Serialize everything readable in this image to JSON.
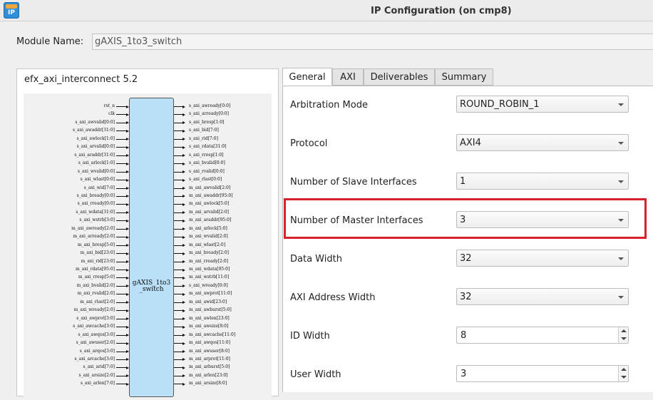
{
  "window": {
    "title": "IP Configuration (on cmp8)",
    "app_icon_text": "IP",
    "app_icon": "ip-catalog-icon"
  },
  "module": {
    "label": "Module Name:",
    "value": "gAXIS_1to3_switch"
  },
  "diagram": {
    "title": "efx_axi_interconnect 5.2",
    "block_label_line1": "gAXIS_1to3",
    "block_label_line2": "_switch",
    "inputs": [
      "rst_n",
      "clk",
      "s_axi_awvalid[0:0]",
      "s_axi_awaddr[31:0]",
      "s_axi_awlock[1:0]",
      "s_axi_arvalid[0:0]",
      "s_axi_araddr[31:0]",
      "s_axi_arlock[1:0]",
      "s_axi_wvalid[0:0]",
      "s_axi_wlast[0:0]",
      "s_axi_wid[7:0]",
      "s_axi_bready[0:0]",
      "s_axi_rready[0:0]",
      "s_axi_wdata[31:0]",
      "s_axi_wstrb[3:0]",
      "m_axi_awready[2:0]",
      "m_axi_arready[2:0]",
      "m_axi_bresp[5:0]",
      "m_axi_bid[23:0]",
      "m_axi_rid[23:0]",
      "m_axi_rdata[95:0]",
      "m_axi_rresp[5:0]",
      "m_axi_bvalid[2:0]",
      "m_axi_rvalid[2:0]",
      "m_axi_rlast[2:0]",
      "m_axi_wready[2:0]",
      "s_axi_awprot[3:0]",
      "s_axi_awcache[3:0]",
      "s_axi_awqos[3:0]",
      "s_axi_awuser[2:0]",
      "s_axi_arqos[3:0]",
      "s_axi_arcache[3:0]",
      "s_axi_arid[7:0]",
      "s_axi_arsize[2:0]",
      "s_axi_arlen[7:0]"
    ],
    "outputs": [
      "s_axi_awready[0:0]",
      "s_axi_arready[0:0]",
      "s_axi_bresp[1:0]",
      "s_axi_bid[7:0]",
      "s_axi_rid[7:0]",
      "s_axi_rdata[31:0]",
      "s_axi_rresp[1:0]",
      "s_axi_bvalid[0:0]",
      "s_axi_rvalid[0:0]",
      "s_axi_rlast[0:0]",
      "m_axi_awvalid[2:0]",
      "m_axi_awaddr[95:0]",
      "m_axi_awlock[5:0]",
      "m_axi_arvalid[2:0]",
      "m_axi_araddr[95:0]",
      "m_axi_arlock[5:0]",
      "m_axi_wvalid[2:0]",
      "m_axi_wlast[2:0]",
      "m_axi_bready[2:0]",
      "m_axi_rready[2:0]",
      "m_axi_wdata[95:0]",
      "m_axi_wstrb[11:0]",
      "s_axi_wready[0:0]",
      "m_axi_awprot[11:0]",
      "m_axi_awid[23:0]",
      "m_axi_awburst[5:0]",
      "m_axi_awlen[23:0]",
      "m_axi_awsize[8:0]",
      "m_axi_awcache[11:0]",
      "m_axi_awqos[11:0]",
      "m_axi_awuser[8:0]",
      "m_axi_arprot[11:0]",
      "m_axi_arburst[5:0]",
      "m_axi_arlen[23:0]",
      "m_axi_arsize[8:0]"
    ]
  },
  "tabs": [
    "General",
    "AXI",
    "Deliverables",
    "Summary"
  ],
  "fields": {
    "arbitration_mode": {
      "label": "Arbitration Mode",
      "value": "ROUND_ROBIN_1"
    },
    "protocol": {
      "label": "Protocol",
      "value": "AXI4"
    },
    "slave_interfaces": {
      "label": "Number of Slave Interfaces",
      "value": "1"
    },
    "master_interfaces": {
      "label": "Number of Master Interfaces",
      "value": "3"
    },
    "data_width": {
      "label": "Data Width",
      "value": "32"
    },
    "address_width": {
      "label": "AXI Address Width",
      "value": "32"
    },
    "id_width": {
      "label": "ID Width",
      "value": "8"
    },
    "user_width": {
      "label": "User Width",
      "value": "3"
    }
  },
  "colors": {
    "highlight": "#d6232b",
    "block_fill": "#b9e0f6"
  }
}
